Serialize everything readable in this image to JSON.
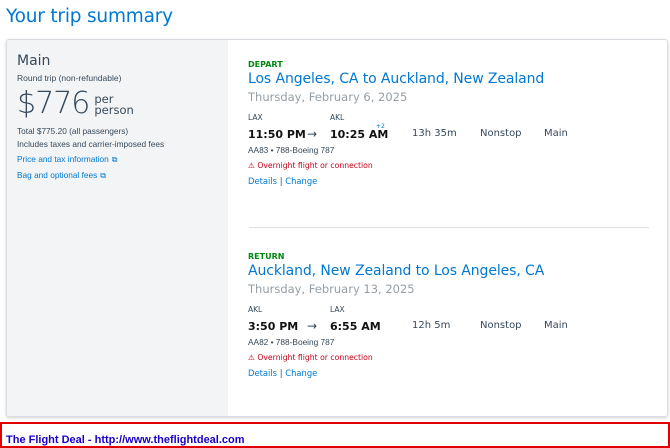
{
  "page": {
    "title": "Your trip summary"
  },
  "fare": {
    "name": "Main",
    "trip_type": "Round trip (non-refundable)",
    "price": "$776",
    "per_line1": "per",
    "per_line2": "person",
    "total": "Total $775.20 (all passengers)",
    "taxes_note": "Includes taxes and carrier-imposed fees",
    "price_tax_link": "Price and tax information",
    "bag_fees_link": "Bag and optional fees"
  },
  "depart": {
    "label": "DEPART",
    "route": "Los Angeles, CA to Auckland, New Zealand",
    "date": "Thursday, February 6, 2025",
    "origin_code": "LAX",
    "dest_code": "AKL",
    "depart_time": "11:50 PM",
    "arrow": "→",
    "arrive_time": "10:25 AM",
    "day_offset": "+2",
    "duration": "13h 35m",
    "stops": "Nonstop",
    "cabin": "Main",
    "flight": "AA83 • 788-Boeing 787",
    "warning": "⚠ Overnight flight or connection",
    "details_link": "Details",
    "separator": "|",
    "change_link": "Change"
  },
  "return": {
    "label": "RETURN",
    "route": "Auckland, New Zealand to Los Angeles, CA",
    "date": "Thursday, February 13, 2025",
    "origin_code": "AKL",
    "dest_code": "LAX",
    "depart_time": "3:50 PM",
    "arrow": "→",
    "arrive_time": "6:55 AM",
    "duration": "12h 5m",
    "stops": "Nonstop",
    "cabin": "Main",
    "flight": "AA82 • 788-Boeing 787",
    "warning": "⚠ Overnight flight or connection",
    "details_link": "Details",
    "separator": "|",
    "change_link": "Change"
  },
  "banner": {
    "text": "The Flight Deal - http://www.theflightdeal.com"
  },
  "icons": {
    "external": "external-link-icon",
    "warning": "warning-icon"
  },
  "colors": {
    "link": "#0078d2",
    "leg_label": "#008712",
    "warning": "#c30019",
    "banner_border": "#e00000",
    "banner_text": "#1a00c8"
  }
}
